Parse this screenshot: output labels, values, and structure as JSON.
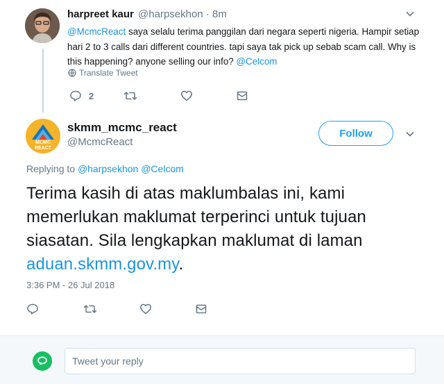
{
  "parent_tweet": {
    "author_name": "harpreet kaur",
    "handle": "@harpsekhon",
    "time": "· 8m",
    "mention": "@McmcReact",
    "body": " saya selalu terima panggilan dari negara seperti nigeria. Hampir setiap hari 2 to 3 calls dari different countries. tapi saya tak pick up sebab scam call. Why is this happening?  anyone selling our info? ",
    "mention_end": "@Celcom",
    "translate_label": "Translate Tweet",
    "reply_count": "2"
  },
  "main_tweet": {
    "author_name": "skmm_mcmc_react",
    "handle": "@McmcReact",
    "follow_label": "Follow",
    "replying_prefix": "Replying to ",
    "replying_to_1": "@harpsekhon",
    "replying_to_2": "@Celcom",
    "body": "Terima kasih di atas maklumbalas ini, kami memerlukan maklumat terperinci  untuk tujuan siasatan. Sila lengkapkan maklumat di laman ",
    "link": "aduan.skmm.gov.my",
    "body_end": ".",
    "timestamp": "3:36 PM - 26 Jul 2018",
    "avatar_text_top": "MCMC",
    "avatar_text_bottom": "REACT"
  },
  "reply_box": {
    "placeholder": "Tweet your reply"
  },
  "colors": {
    "accent": "#1da1f2",
    "link": "#1b95e0",
    "muted": "#657786",
    "reply_avatar": "#17bf63"
  }
}
